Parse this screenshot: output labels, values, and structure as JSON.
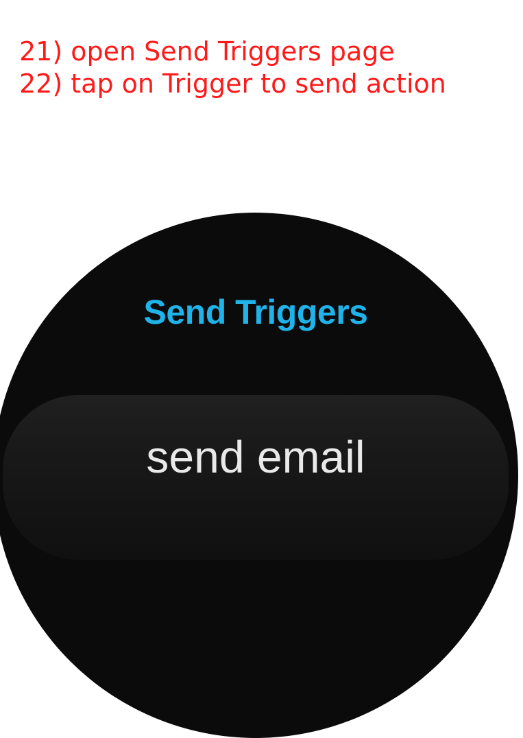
{
  "instructions": [
    "21) open Send Triggers page",
    "22) tap on Trigger to send action"
  ],
  "screen": {
    "title": "Send Triggers",
    "triggers": [
      {
        "label": "send email"
      }
    ]
  },
  "colors": {
    "instruction_text": "#ff1a1a",
    "title": "#1fb3ea",
    "watch_background": "#0b0b0b",
    "item_text": "#e9e9e9"
  }
}
